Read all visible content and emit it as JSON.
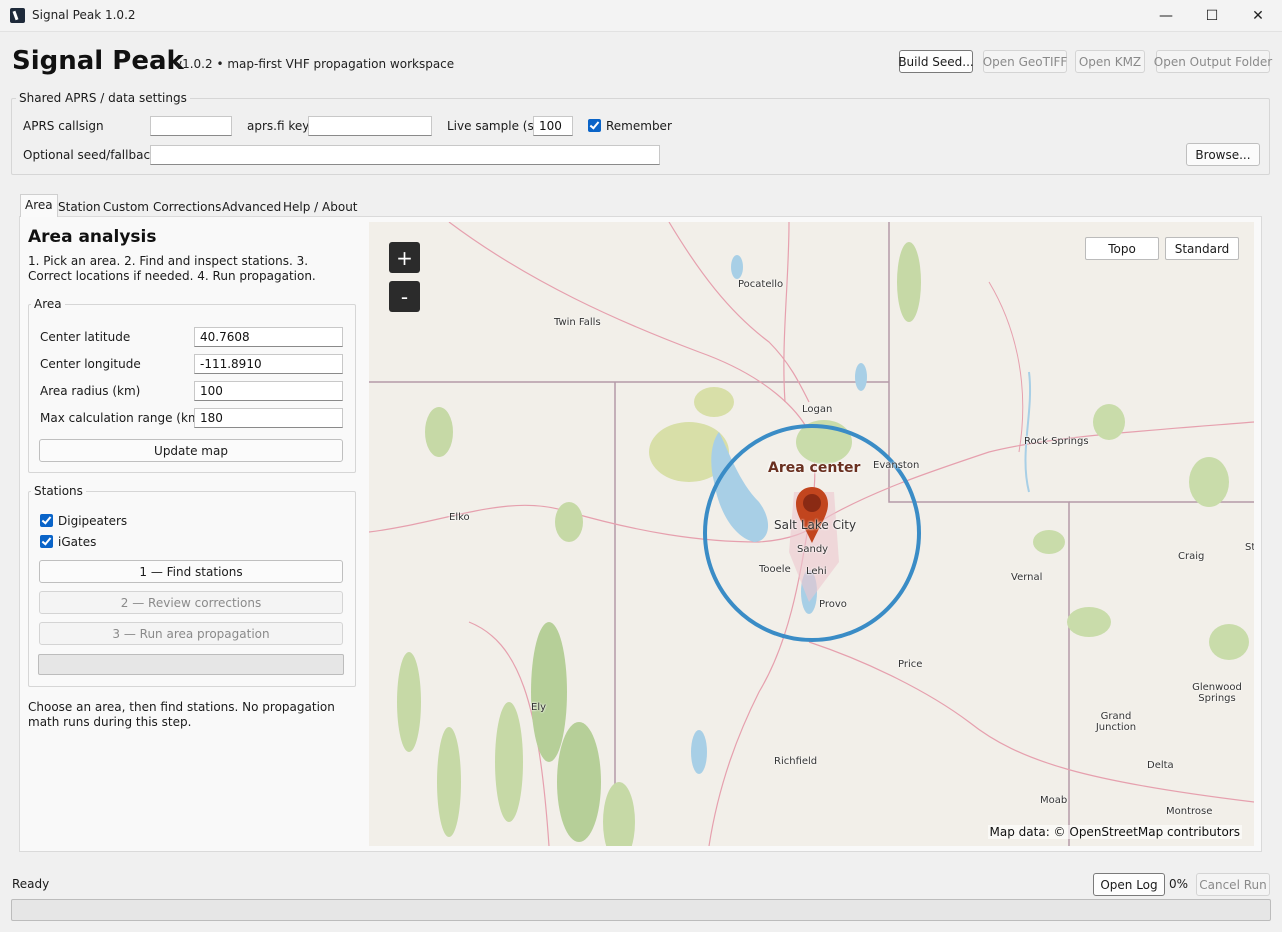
{
  "window": {
    "title": "Signal Peak 1.0.2",
    "minimize": "—",
    "maximize": "☐",
    "close": "✕"
  },
  "header": {
    "app_name": "Signal Peak",
    "subtitle": "v1.0.2  •  map-first VHF propagation workspace",
    "buttons": {
      "build_seed": "Build Seed...",
      "open_geotiff": "Open GeoTIFF",
      "open_kmz": "Open KMZ",
      "open_output": "Open Output Folder"
    }
  },
  "shared": {
    "group_title": "Shared APRS / data settings",
    "callsign_label": "APRS callsign",
    "callsign_value": "",
    "key_label": "aprs.fi key",
    "key_value": "",
    "live_sample_label": "Live sample (s)",
    "live_sample_value": "100",
    "remember_label": "Remember",
    "seed_label": "Optional seed/fallback",
    "seed_value": "",
    "browse": "Browse..."
  },
  "tabs": [
    "Area",
    "Station",
    "Custom",
    "Corrections",
    "Advanced",
    "Help / About"
  ],
  "area_tab": {
    "title": "Area analysis",
    "steps": "1. Pick an area.  2. Find and inspect stations.  3. Correct locations if needed.  4. Run propagation.",
    "area_group": "Area",
    "center_lat_label": "Center latitude",
    "center_lat_value": "40.7608",
    "center_lon_label": "Center longitude",
    "center_lon_value": "-111.8910",
    "radius_label": "Area radius (km)",
    "radius_value": "100",
    "max_range_label": "Max calculation range (km)",
    "max_range_value": "180",
    "update_map": "Update map",
    "stations_group": "Stations",
    "digipeaters": "Digipeaters",
    "igates": "iGates",
    "find_stations": "1 — Find stations",
    "review_corrections": "2 — Review corrections",
    "run_area": "3 — Run area propagation",
    "note": "Choose an area, then find stations. No propagation math runs during this step."
  },
  "map": {
    "zoom_in": "+",
    "zoom_out": "-",
    "topo": "Topo",
    "standard": "Standard",
    "marker_label": "Area center",
    "attribution": "Map data: © OpenStreetMap contributors",
    "cities": {
      "pocatello": "Pocatello",
      "twin_falls": "Twin Falls",
      "logan": "Logan",
      "rock_springs": "Rock Springs",
      "evanston": "Evanston",
      "elko": "Elko",
      "salt_lake_city": "Salt Lake City",
      "sandy": "Sandy",
      "tooele": "Tooele",
      "lehi": "Lehi",
      "provo": "Provo",
      "craig": "Craig",
      "vernal": "Vernal",
      "price": "Price",
      "glenwood_springs": "Glenwood Springs",
      "ely": "Ely",
      "grand_junction": "Grand Junction",
      "richfield": "Richfield",
      "delta": "Delta",
      "moab": "Moab",
      "montrose": "Montrose",
      "st": "St"
    }
  },
  "status": {
    "text": "Ready",
    "open_log": "Open Log",
    "percent": "0%",
    "cancel": "Cancel Run"
  },
  "colors": {
    "accent": "#0a64c8",
    "radius_circle": "#3a8cc6",
    "marker": "#c2451e"
  }
}
